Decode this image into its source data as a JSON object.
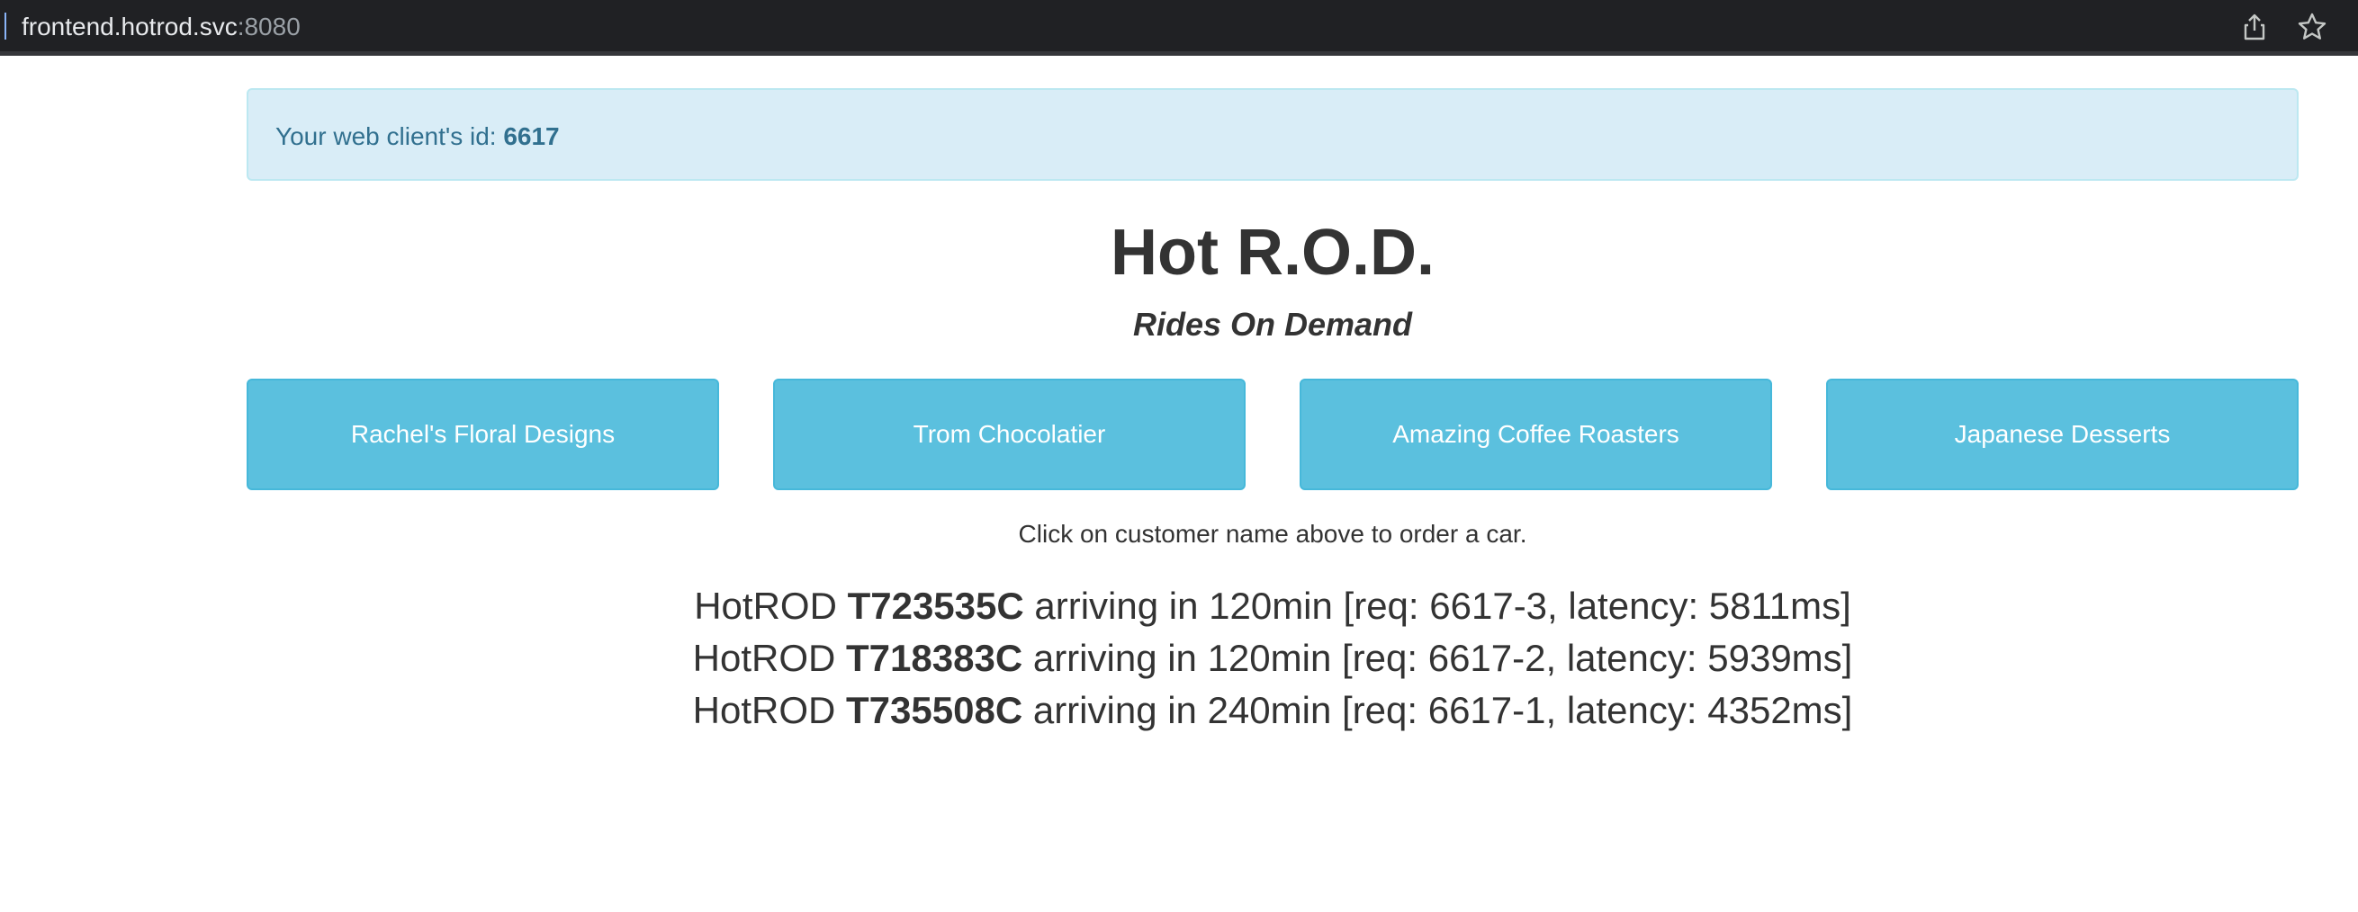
{
  "browser": {
    "url_host": "frontend.hotrod.svc",
    "url_port": ":8080",
    "icons": [
      "share-icon",
      "star-icon"
    ]
  },
  "alert": {
    "prefix": "Your web client's id: ",
    "client_id": "6617"
  },
  "header": {
    "title": "Hot R.O.D.",
    "subtitle": "Rides On Demand"
  },
  "customers": [
    {
      "label": "Rachel's Floral Designs"
    },
    {
      "label": "Trom Chocolatier"
    },
    {
      "label": "Amazing Coffee Roasters"
    },
    {
      "label": "Japanese Desserts"
    }
  ],
  "hint": "Click on customer name above to order a car.",
  "rides": [
    {
      "prefix": "HotROD ",
      "plate": "T723535C",
      "suffix": " arriving in 120min [req: 6617-3, latency: 5811ms]"
    },
    {
      "prefix": "HotROD ",
      "plate": "T718383C",
      "suffix": " arriving in 120min [req: 6617-2, latency: 5939ms]"
    },
    {
      "prefix": "HotROD ",
      "plate": "T735508C",
      "suffix": " arriving in 240min [req: 6617-1, latency: 4352ms]"
    }
  ],
  "colors": {
    "alert_bg": "#d9edf7",
    "alert_text": "#31708f",
    "button_bg": "#5bc0de",
    "text": "#333333"
  }
}
